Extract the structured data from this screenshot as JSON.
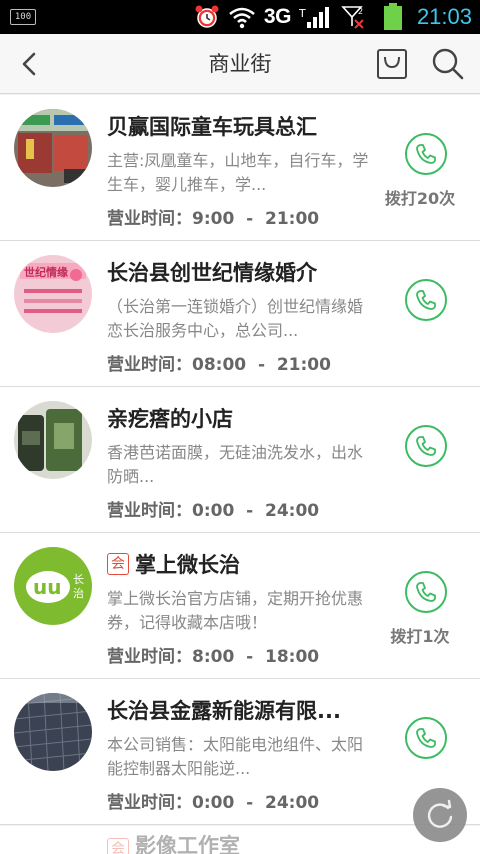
{
  "status_bar": {
    "battery_label": "100",
    "network": "3G",
    "time": "21:03"
  },
  "header": {
    "title": "商业街"
  },
  "items": [
    {
      "name": "贝赢国际童车玩具总汇",
      "tag": "",
      "desc": "主营:凤凰童车，山地车，自行车，学生车，婴儿推车，学...",
      "hours": "营业时间：9:00  -  21:00",
      "calls": "拨打20次"
    },
    {
      "name": "长治县创世纪情缘婚介",
      "tag": "",
      "desc": "（长治第一连锁婚介）创世纪情缘婚恋长治服务中心，总公司...",
      "hours": "营业时间：08:00  -  21:00",
      "calls": ""
    },
    {
      "name": "亲疙瘩的小店",
      "tag": "",
      "desc": "香港芭诺面膜，无硅油洗发水，出水防晒...",
      "hours": "营业时间：0:00  -  24:00",
      "calls": ""
    },
    {
      "name": "掌上微长治",
      "tag": "会",
      "desc": "掌上微长治官方店铺，定期开抢优惠券，记得收藏本店哦！",
      "hours": "营业时间：8:00  -  18:00",
      "calls": "拨打1次"
    },
    {
      "name": "长治县金露新能源有限...",
      "tag": "",
      "desc": "本公司销售：太阳能电池组件、太阳能控制器太阳能逆...",
      "hours": "营业时间：0:00  -  24:00",
      "calls": ""
    }
  ],
  "partial_item": {
    "tag": "会",
    "name": "影像工作室"
  },
  "colors": {
    "accent_green": "#3dbb62",
    "tag_red": "#e34c3a",
    "clock_blue": "#3fc6e9"
  }
}
